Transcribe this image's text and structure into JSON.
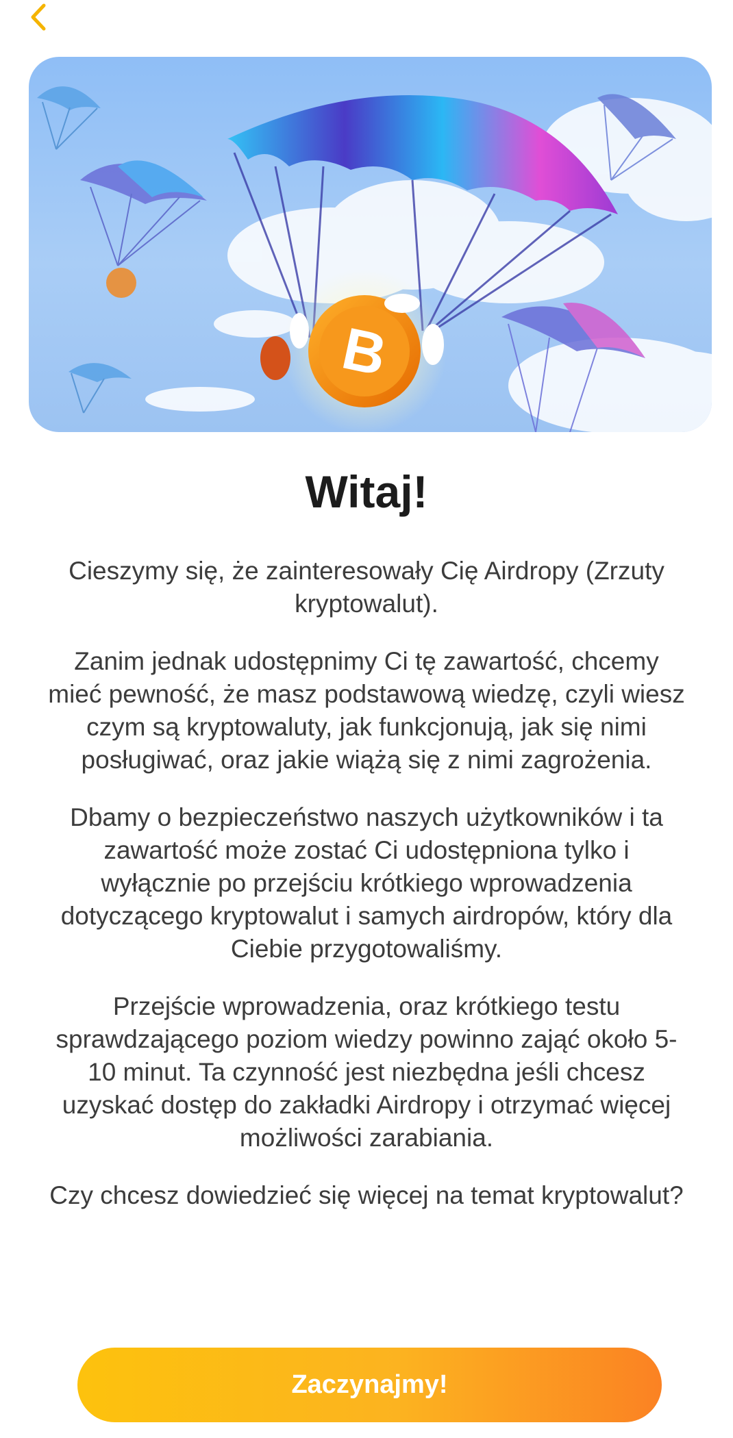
{
  "nav": {
    "back_icon": "chevron-left-icon",
    "accent_color": "#f5b400"
  },
  "hero": {
    "illustration": "bitcoin-coin-parachute-illustration"
  },
  "title": "Witaj!",
  "paragraphs": [
    "Cieszymy się, że zainteresowały Cię Airdropy (Zrzuty kryptowalut).",
    "Zanim jednak udostępnimy Ci tę zawartość, chcemy mieć pewność, że masz podstawową wiedzę, czyli wiesz czym są kryptowaluty, jak funkcjonują, jak się nimi posługiwać, oraz jakie wiążą się z nimi zagrożenia.",
    "Dbamy o bezpieczeństwo naszych użytkowników i ta zawartość może zostać Ci udostępniona tylko i wyłącznie po przejściu krótkiego wprowadzenia dotyczącego kryptowalut i samych airdropów, który dla Ciebie przygotowaliśmy.",
    "Przejście wprowadzenia, oraz krótkiego testu sprawdzającego poziom wiedzy powinno zająć około 5-10 minut. Ta czynność jest niezbędna jeśli chcesz uzyskać dostęp do zakładki Airdropy i otrzymać więcej możliwości zarabiania.",
    "Czy chcesz dowiedzieć się więcej na temat kryptowalut?"
  ],
  "cta": {
    "label": "Zaczynajmy!",
    "gradient_start": "#fdc20d",
    "gradient_end": "#fb8223"
  }
}
